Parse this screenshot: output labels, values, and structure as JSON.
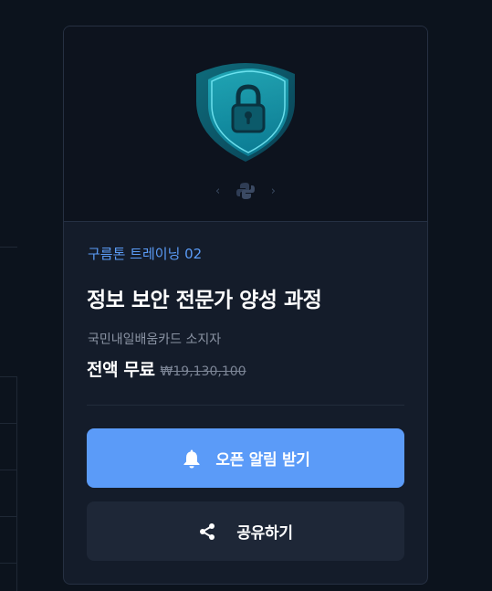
{
  "course_card": {
    "category": "구름톤 트레이닝 02",
    "title": "정보 보안 전문가 양성 과정",
    "eligibility": "국민내일배움카드 소지자",
    "price_label": "전액 무료",
    "original_price": "₩19,130,100",
    "thumbnail_icon": "shield-lock-icon",
    "accent_color": "#5b9bf8"
  },
  "actions": {
    "notify_label": "오픈 알림 받기",
    "notify_icon": "bell-icon",
    "share_label": "공유하기",
    "share_icon": "share-icon"
  },
  "carousel": {
    "prev_icon": "chevron-left-icon",
    "next_icon": "chevron-right-icon",
    "center_icon": "python-logo-icon"
  }
}
